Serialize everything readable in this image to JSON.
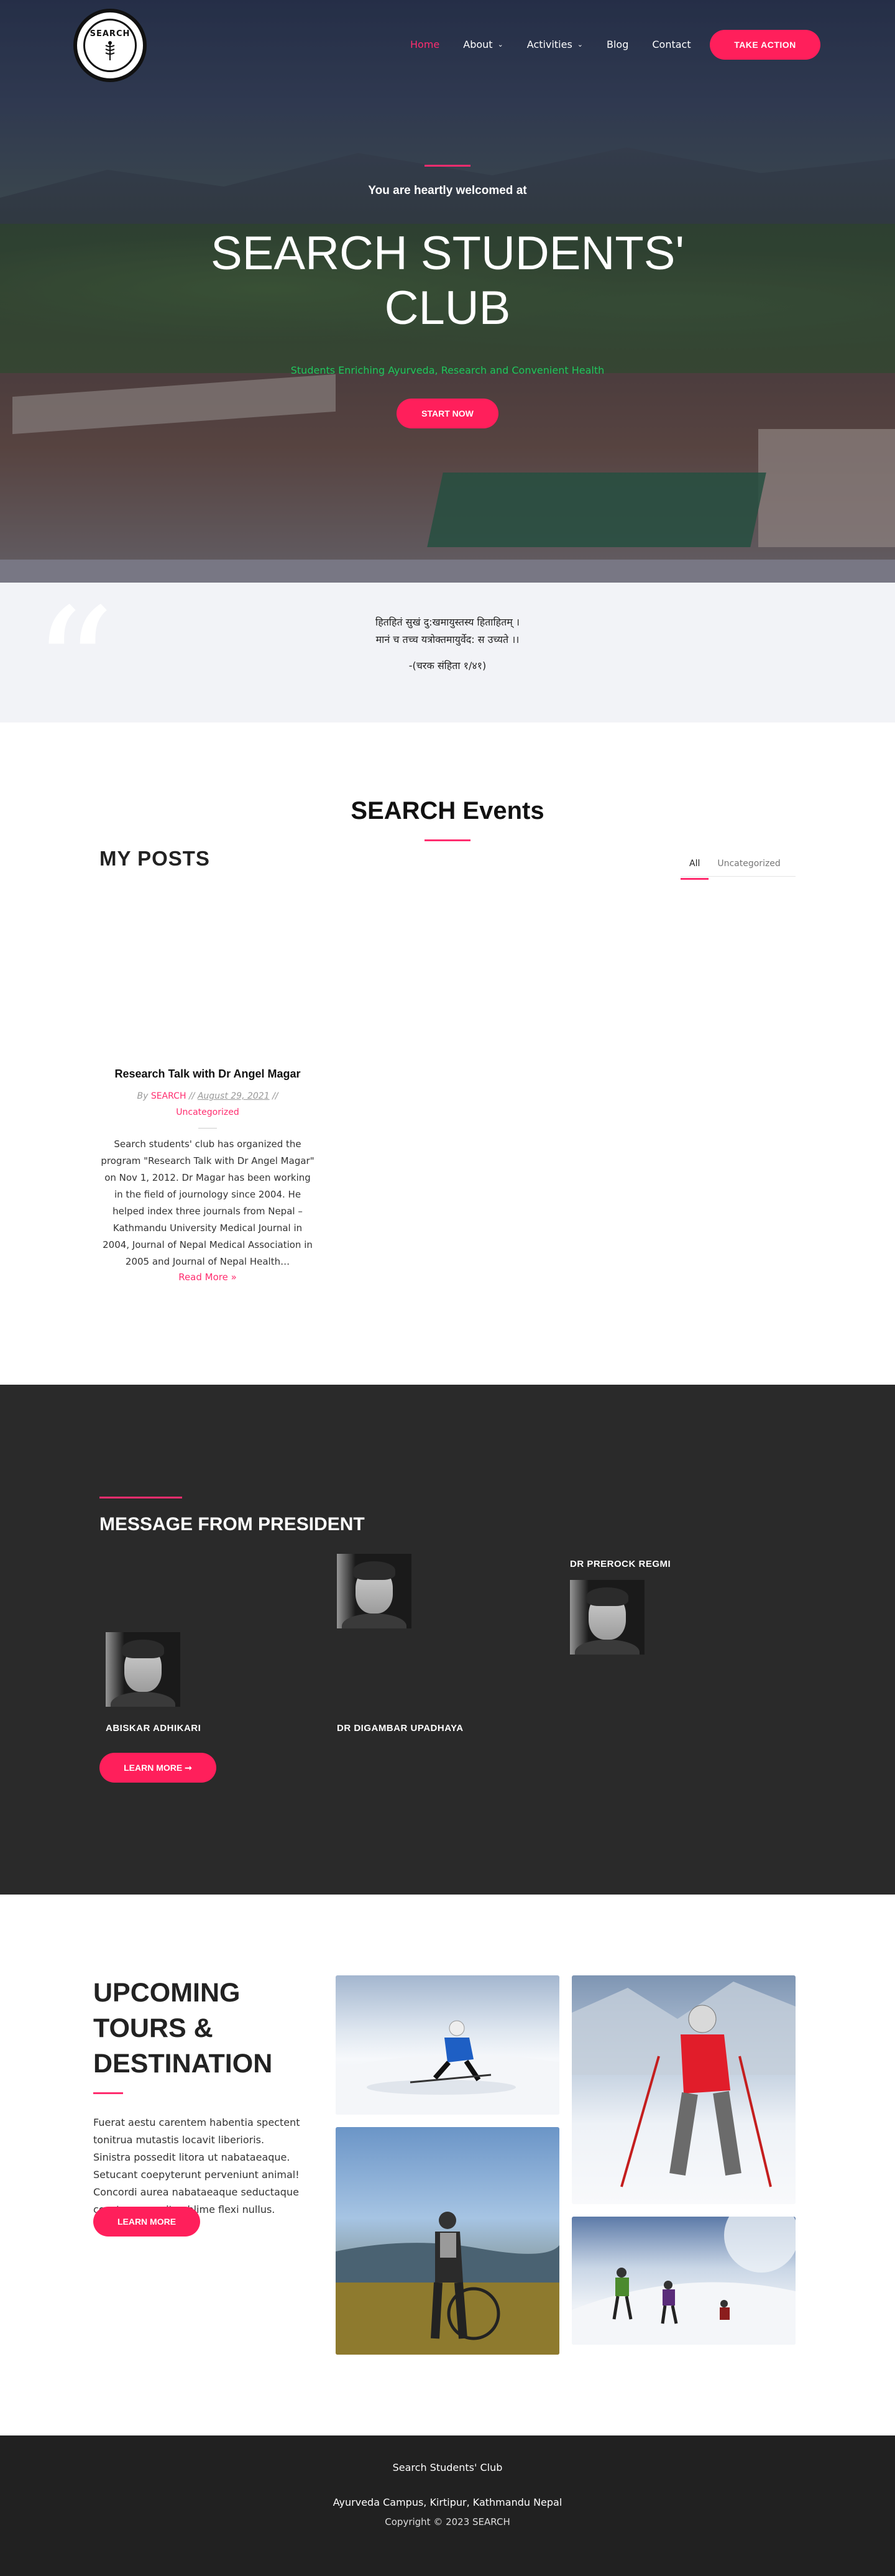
{
  "nav": {
    "logo_text": "SEARCH",
    "items": [
      {
        "label": "Home",
        "active": true
      },
      {
        "label": "About",
        "dropdown": true
      },
      {
        "label": "Activities",
        "dropdown": true
      },
      {
        "label": "Blog"
      },
      {
        "label": "Contact"
      }
    ],
    "cta": "TAKE ACTION"
  },
  "hero": {
    "welcome": "You are heartly welcomed at",
    "title": "SEARCH STUDENTS' CLUB",
    "tagline": "Students  Enriching Ayurveda, Research and Convenient Health",
    "button": "START NOW"
  },
  "quote": {
    "line1": "हितहितं सुखं दु:खमायुस्तस्य हिताहितम् ।",
    "line2": "मानं च तच्च यत्रोक्तमायुर्वेद: स उच्यते ।।",
    "cite": "-(चरक संहिता १/४१)"
  },
  "events": {
    "title": "SEARCH Events",
    "posts_heading": "MY POSTS",
    "filters": [
      "All",
      "Uncategorized"
    ],
    "post": {
      "title": "Research Talk with Dr Angel Magar",
      "by": "By",
      "author": "SEARCH",
      "sep": "//",
      "date": "August 29, 2021",
      "category": "Uncategorized",
      "excerpt": "Search students' club has organized the program \"Research Talk with Dr Angel Magar\" on Nov 1, 2012. Dr Magar has been working in the field of journology since 2004. He helped index three journals from Nepal – Kathmandu University Medical Journal in 2004, Journal of Nepal Medical Association in 2005 and Journal of Nepal Health…",
      "read_more": "Read More »"
    }
  },
  "president": {
    "title": "MESSAGE FROM PRESIDENT",
    "members": [
      {
        "name": "ABISKAR ADHIKARI"
      },
      {
        "name": "DR DIGAMBAR UPADHAYA"
      },
      {
        "name": "DR PREROCK REGMI"
      }
    ],
    "button": "LEARN MORE ➞"
  },
  "tours": {
    "title": "UPCOMING TOURS & DESTINATION",
    "text": "Fuerat aestu carentem habentia spectent tonitrua mutastis locavit liberioris. Sinistra possedit litora ut nabataeaque. Setucant coepyterunt perveniunt animal! Concordi aurea nabataeaque seductaque constaque cepit sublime flexi nullus.",
    "button": "LEARN MORE"
  },
  "footer": {
    "club": "Search Students' Club",
    "address": "Ayurveda Campus, Kirtipur, Kathmandu Nepal",
    "copyright": "Copyright © 2023 SEARCH"
  },
  "colors": {
    "accent": "#ff1f5b",
    "tagline": "#22c55e",
    "dark": "#2a2a2a",
    "footer": "#212121"
  }
}
